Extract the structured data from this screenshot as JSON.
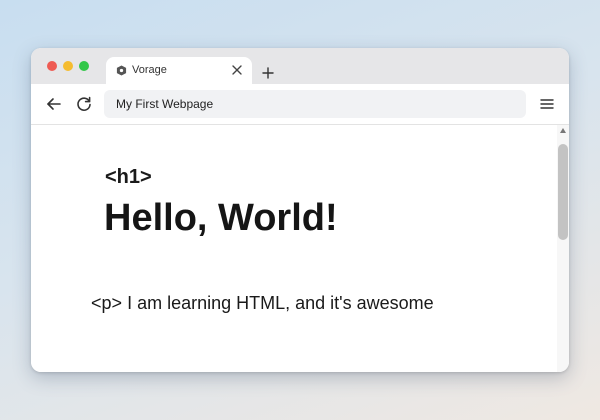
{
  "browser": {
    "traffic_lights": {
      "close_color": "#ee5b53",
      "minimize_color": "#f5bc2f",
      "maximize_color": "#32c748"
    },
    "tab": {
      "title": "Vorage",
      "favicon": "hexagon-icon",
      "close_icon": "close-icon"
    },
    "new_tab_icon": "plus-icon",
    "toolbar": {
      "back_icon": "arrow-left-icon",
      "reload_icon": "reload-icon",
      "address": "My First Webpage",
      "menu_icon": "hamburger-menu-icon"
    }
  },
  "page": {
    "h1_tag": "<h1>",
    "heading": "Hello, World!",
    "paragraph_tag": "<p>",
    "paragraph": "I am learning HTML, and it's awesome"
  }
}
